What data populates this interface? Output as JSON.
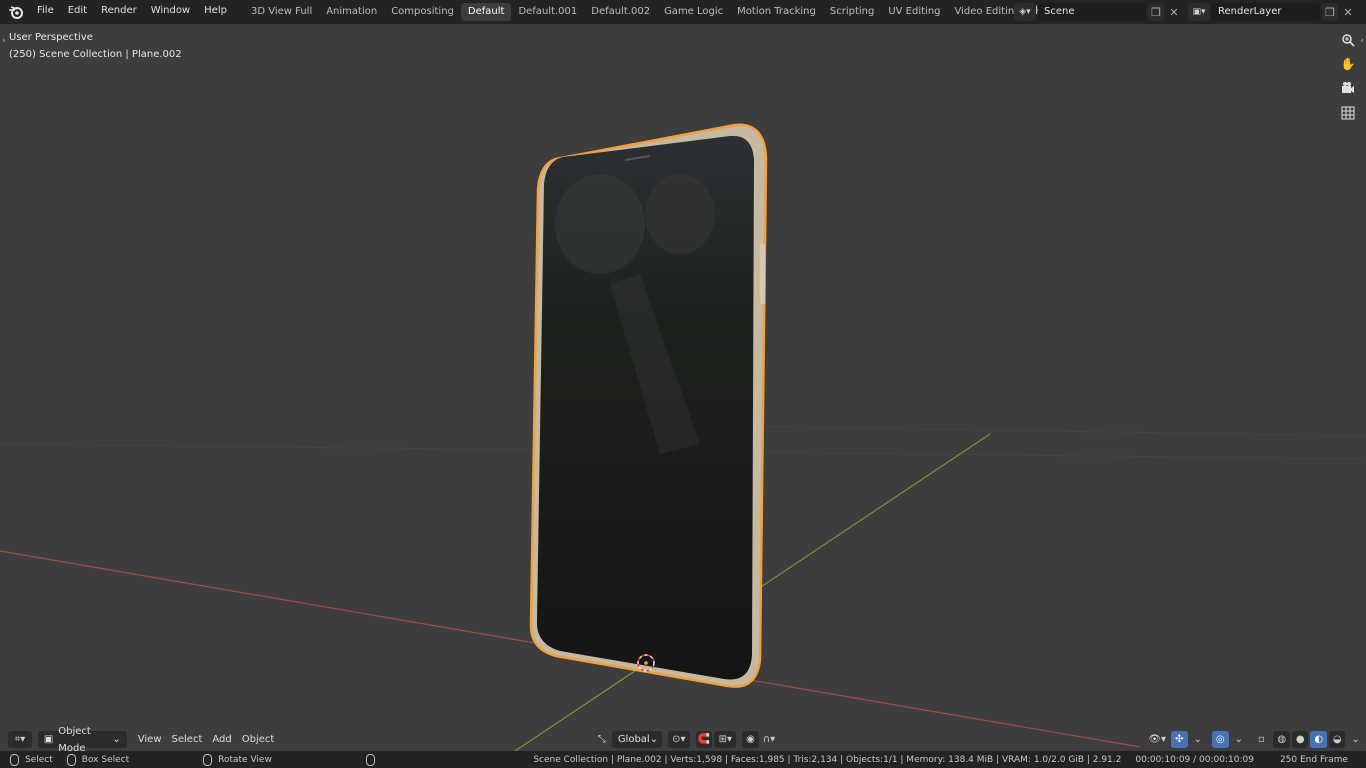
{
  "menu": [
    "File",
    "Edit",
    "Render",
    "Window",
    "Help"
  ],
  "workspaces": [
    "3D View Full",
    "Animation",
    "Compositing",
    "Default",
    "Default.001",
    "Default.002",
    "Game Logic",
    "Motion Tracking",
    "Scripting",
    "UV Editing",
    "Video Editing"
  ],
  "active_workspace": "Default",
  "add_workspace": "+",
  "scene": {
    "name": "Scene"
  },
  "view_layer": {
    "name": "RenderLayer"
  },
  "viewport": {
    "perspective": "User Perspective",
    "collection_info": "(250) Scene Collection | Plane.002"
  },
  "header": {
    "mode": "Object Mode",
    "view": "View",
    "select": "Select",
    "add": "Add",
    "object": "Object",
    "orientation": "Global"
  },
  "status": {
    "select": "Select",
    "box_select": "Box Select",
    "rotate_view": "Rotate View",
    "stats": "Scene Collection | Plane.002 | Verts:1,598 | Faces:1,985 | Tris:2,134 | Objects:1/1 | Memory: 138.4 MiB | VRAM: 1.0/2.0 GiB | 2.91.2",
    "time": "00:00:10:09 / 00:00:10:09",
    "end_frame": "250 End Frame"
  },
  "colors": {
    "accent": "#4772b3",
    "selection_outline": "#f0a040",
    "x_axis": "#a34b4b",
    "y_axis": "#6f9a35"
  }
}
